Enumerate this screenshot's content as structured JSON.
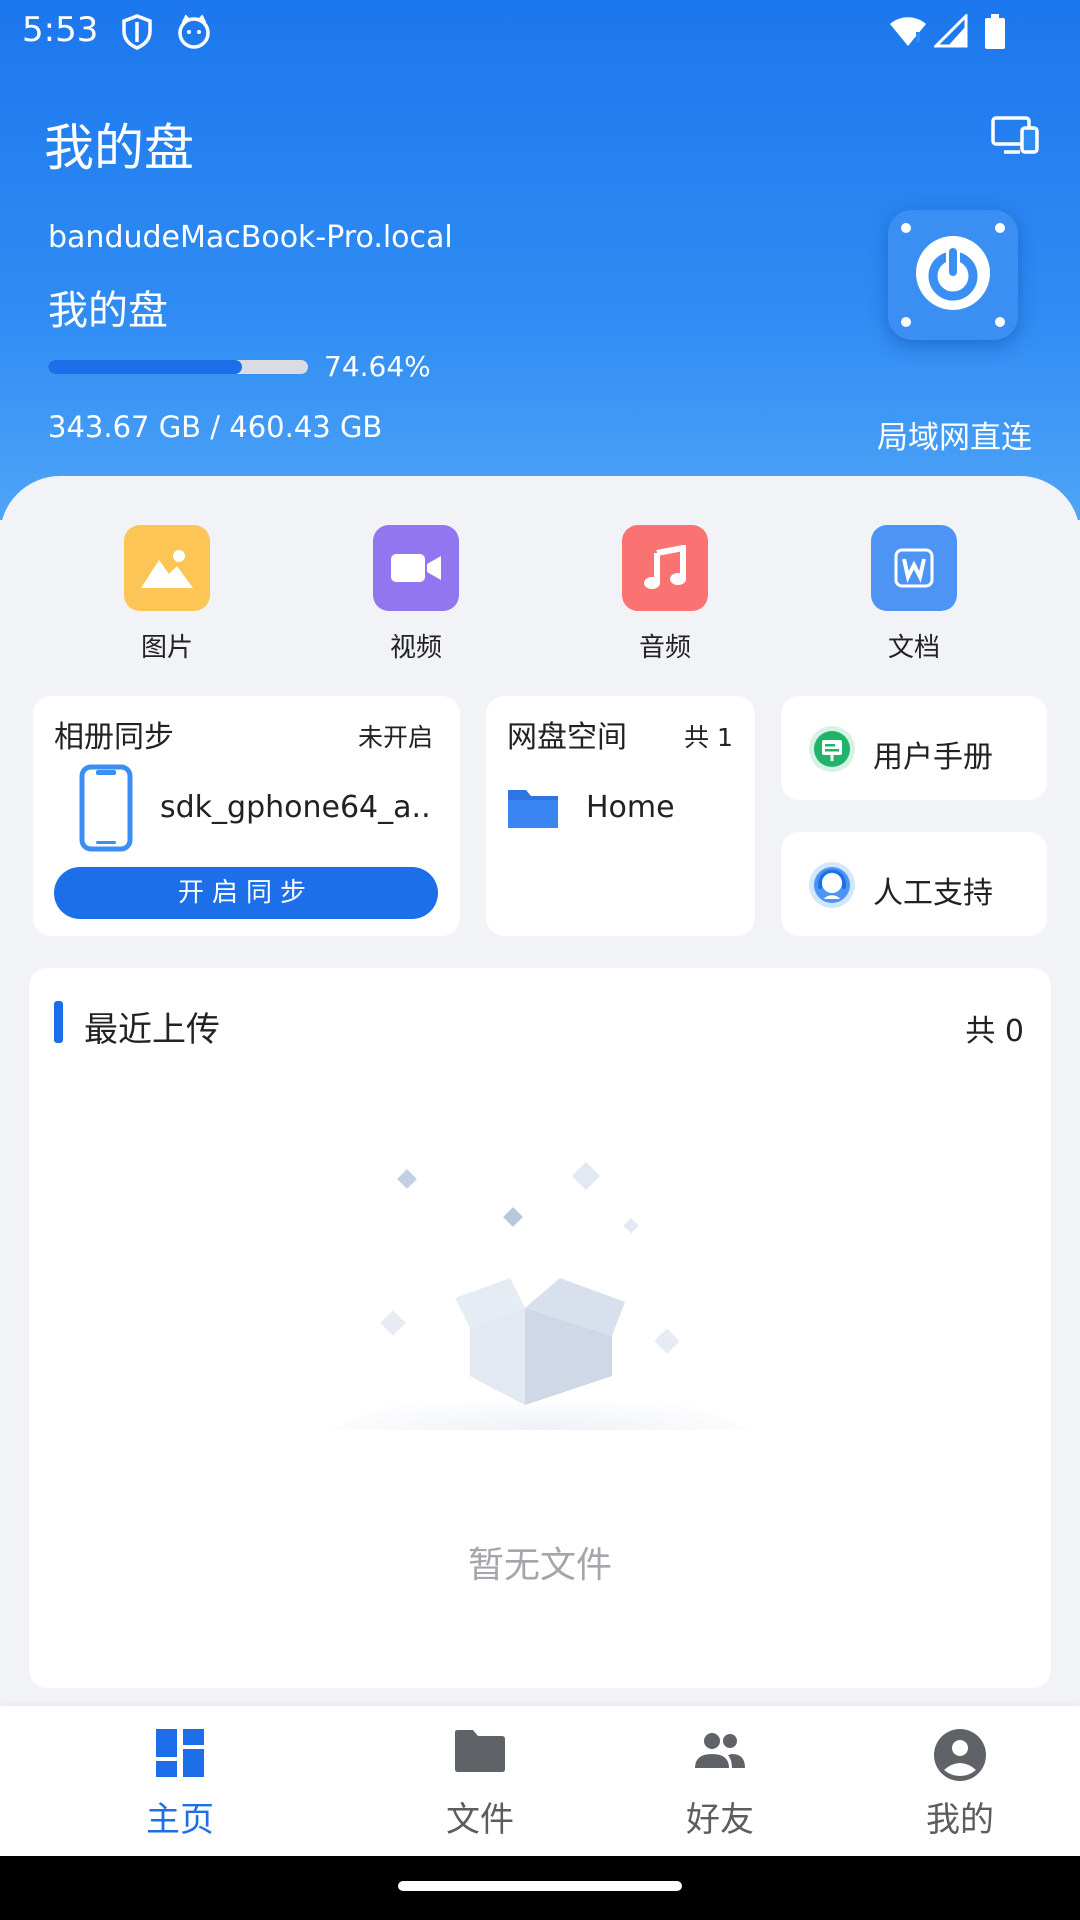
{
  "status_bar": {
    "time": "5:53"
  },
  "header": {
    "title": "我的盘",
    "host_name": "bandudeMacBook-Pro.local",
    "disk_name": "我的盘",
    "usage_percent_text": "74.64%",
    "usage_fraction": 0.7464,
    "storage_text": "343.67 GB / 460.43 GB",
    "connection_mode": "局域网直连"
  },
  "categories": [
    {
      "label": "图片",
      "icon": "image-icon",
      "color": "#fdc556"
    },
    {
      "label": "视频",
      "icon": "video-camera-icon",
      "color": "#9276f0"
    },
    {
      "label": "音频",
      "icon": "music-note-icon",
      "color": "#fb7272"
    },
    {
      "label": "文档",
      "icon": "word-document-icon",
      "color": "#4d94f5"
    }
  ],
  "album_sync": {
    "title": "相册同步",
    "status": "未开启",
    "device_name": "sdk_gphone64_a...",
    "button_label": "开启同步"
  },
  "cloud_space": {
    "title": "网盘空间",
    "count": "共 1",
    "folder_name": "Home"
  },
  "side_links": [
    {
      "label": "用户手册",
      "icon": "user-manual-icon",
      "color": "#22b36b"
    },
    {
      "label": "人工支持",
      "icon": "customer-support-icon",
      "color": "#4d94f5"
    }
  ],
  "recent_uploads": {
    "title": "最近上传",
    "count": "共 0",
    "empty_text": "暂无文件"
  },
  "bottom_nav": [
    {
      "label": "主页",
      "icon": "dashboard-icon",
      "active": true
    },
    {
      "label": "文件",
      "icon": "folder-icon",
      "active": false
    },
    {
      "label": "好友",
      "icon": "friends-icon",
      "active": false
    },
    {
      "label": "我的",
      "icon": "profile-icon",
      "active": false
    }
  ],
  "colors": {
    "primary": "#1c6fe8",
    "header_gradient_top": "#1c77ee",
    "header_gradient_bottom": "#4ea4f7"
  }
}
